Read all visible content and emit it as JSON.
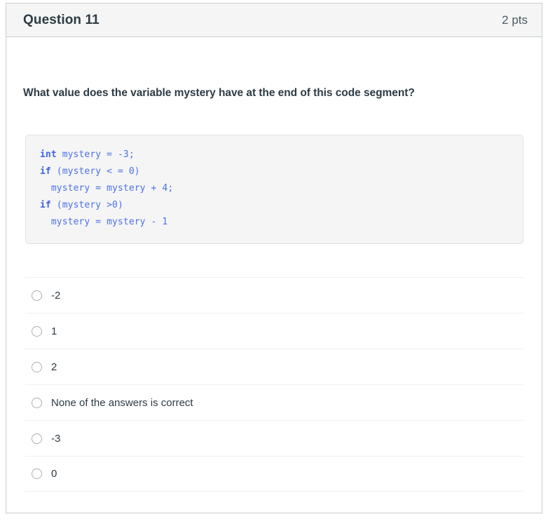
{
  "header": {
    "title": "Question 11",
    "points": "2 pts"
  },
  "question": {
    "text": "What value does the variable mystery have at the end of this code segment?"
  },
  "code": {
    "lines": [
      {
        "keyword": "int",
        "rest": " mystery = -3;",
        "indent": ""
      },
      {
        "keyword": "if",
        "rest": " (mystery < = 0)",
        "indent": ""
      },
      {
        "keyword": "",
        "rest": "mystery = mystery + 4;",
        "indent": "  "
      },
      {
        "keyword": "if",
        "rest": " (mystery >0)",
        "indent": ""
      },
      {
        "keyword": "",
        "rest": "mystery = mystery - 1",
        "indent": "  "
      }
    ]
  },
  "answers": {
    "options": [
      {
        "label": "-2",
        "selected": false
      },
      {
        "label": "1",
        "selected": false
      },
      {
        "label": "2",
        "selected": false
      },
      {
        "label": "None of the answers is correct",
        "selected": false
      },
      {
        "label": "-3",
        "selected": false
      },
      {
        "label": "0",
        "selected": false
      }
    ]
  },
  "colors": {
    "header_bg": "#f5f5f5",
    "card_border": "#c7cdd1",
    "code_bg": "#f5f5f5",
    "code_text": "#4a72e8",
    "text": "#2d3b45"
  }
}
